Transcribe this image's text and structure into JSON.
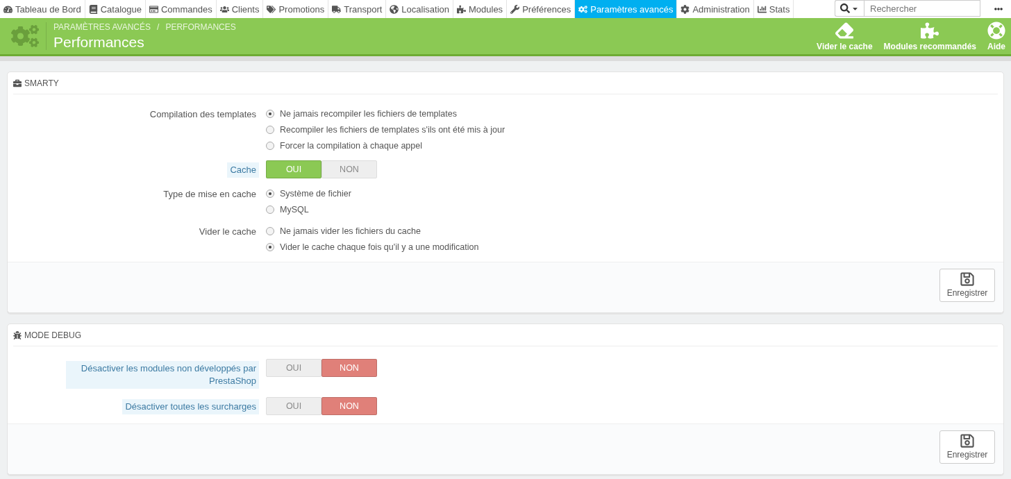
{
  "nav": {
    "items": [
      {
        "label": "Tableau de Bord",
        "selected": false
      },
      {
        "label": "Catalogue",
        "selected": false
      },
      {
        "label": "Commandes",
        "selected": false
      },
      {
        "label": "Clients",
        "selected": false
      },
      {
        "label": "Promotions",
        "selected": false
      },
      {
        "label": "Transport",
        "selected": false
      },
      {
        "label": "Localisation",
        "selected": false
      },
      {
        "label": "Modules",
        "selected": false
      },
      {
        "label": "Préférences",
        "selected": false
      },
      {
        "label": "Paramètres avancés",
        "selected": true
      },
      {
        "label": "Administration",
        "selected": false
      },
      {
        "label": "Stats",
        "selected": false
      }
    ],
    "search": {
      "placeholder": "Rechercher"
    }
  },
  "header": {
    "breadcrumb": [
      "PARAMÈTRES AVANCÉS",
      "PERFORMANCES"
    ],
    "breadcrumb_separator": "/",
    "title": "Performances",
    "actions": [
      "Vider le cache",
      "Modules recommandés",
      "Aide"
    ]
  },
  "panels": [
    {
      "title": "SMARTY",
      "save": "Enregistrer",
      "fields": [
        {
          "kind": "radio",
          "label": "Compilation des templates",
          "help": false,
          "options": [
            {
              "label": "Ne jamais recompiler les fichiers de templates",
              "selected": true
            },
            {
              "label": "Recompiler les fichiers de templates s'ils ont été mis à jour",
              "selected": false
            },
            {
              "label": "Forcer la compilation à chaque appel",
              "selected": false
            }
          ]
        },
        {
          "kind": "switch",
          "label": "Cache",
          "help": true,
          "options": [
            {
              "label": "OUI",
              "selected": true
            },
            {
              "label": "NON",
              "selected": false
            }
          ]
        },
        {
          "kind": "radio",
          "label": "Type de mise en cache",
          "help": false,
          "options": [
            {
              "label": "Système de fichier",
              "selected": true
            },
            {
              "label": "MySQL",
              "selected": false
            }
          ]
        },
        {
          "kind": "radio",
          "label": "Vider le cache",
          "help": false,
          "options": [
            {
              "label": "Ne jamais vider les fichiers du cache",
              "selected": false
            },
            {
              "label": "Vider le cache chaque fois qu'il y a une modification",
              "selected": true
            }
          ]
        }
      ]
    },
    {
      "title": "MODE DEBUG",
      "save": "Enregistrer",
      "fields": [
        {
          "kind": "switch",
          "label": "Désactiver les modules non développés par PrestaShop",
          "help": true,
          "options": [
            {
              "label": "OUI",
              "selected": false
            },
            {
              "label": "NON",
              "selected": true
            }
          ]
        },
        {
          "kind": "switch",
          "label": "Désactiver toutes les surcharges",
          "help": true,
          "options": [
            {
              "label": "OUI",
              "selected": false
            },
            {
              "label": "NON",
              "selected": true
            }
          ]
        }
      ]
    }
  ]
}
